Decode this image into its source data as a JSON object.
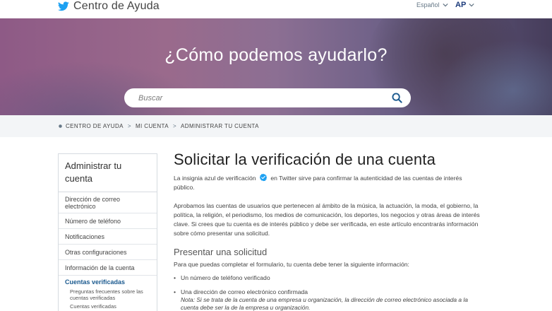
{
  "header": {
    "brand_title": "Centro de Ayuda",
    "language": "Español",
    "account_initials": "AP",
    "brand_color": "#1da1f2"
  },
  "hero": {
    "title": "¿Cómo podemos ayudarlo?",
    "search_placeholder": "Buscar"
  },
  "breadcrumb": {
    "items": [
      "CENTRO DE AYUDA",
      "MI CUENTA",
      "ADMINISTRAR TU CUENTA"
    ],
    "separator": ">"
  },
  "sidebar": {
    "heading": "Administrar tu cuenta",
    "items": [
      "Dirección de correo electrónico",
      "Número de teléfono",
      "Notificaciones",
      "Otras configuraciones",
      "Información de la cuenta",
      "Cuentas verificadas"
    ],
    "subitems": [
      "Preguntas frecuentes sobre las cuentas verificadas",
      "Cuentas verificadas"
    ]
  },
  "article": {
    "title": "Solicitar la verificación de una cuenta",
    "intro_before": "La insignia azul de verificación",
    "intro_after": "en Twitter sirve para confirmar la autenticidad de las cuentas de interés público.",
    "paragraph2": "Aprobamos las cuentas de usuarios que pertenecen al ámbito de la música, la actuación, la moda, el gobierno, la política, la religión, el periodismo, los medios de comunicación, los deportes, los negocios y otras áreas de interés clave. Si crees que tu cuenta es de interés público y debe ser verificada, en este artículo encontrarás información sobre cómo presentar una solicitud.",
    "section_heading": "Presentar una solicitud",
    "section_intro": "Para que puedas completar el formulario, tu cuenta debe tener la siguiente información:",
    "bullets": [
      "Un número de teléfono verificado",
      "Una dirección de correo electrónico confirmada"
    ],
    "note": "Nota: Si se trata de la cuenta de una empresa u organización, la dirección de correo electrónico asociada a la cuenta debe ser la de la empresa u organización."
  }
}
